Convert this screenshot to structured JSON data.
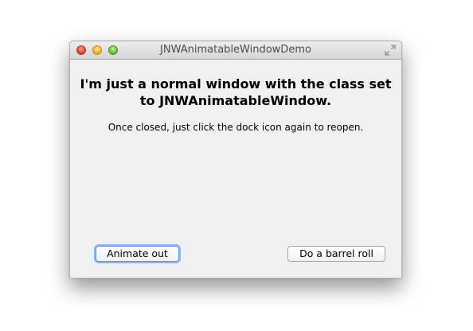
{
  "window": {
    "title": "JNWAnimatableWindowDemo"
  },
  "content": {
    "headline_line1": "I'm just a normal window with the class set",
    "headline_line2": "to JNWAnimatableWindow.",
    "subtext": "Once closed, just click the dock icon again to reopen."
  },
  "buttons": {
    "animate_out": "Animate out",
    "barrel_roll": "Do a barrel roll"
  },
  "colors": {
    "close": "#e0443b",
    "minimize": "#f1b134",
    "zoom": "#66c13c",
    "focus_ring": "#8fb5ef"
  },
  "icons": [
    "close-icon",
    "minimize-icon",
    "zoom-icon",
    "fullscreen-icon"
  ]
}
